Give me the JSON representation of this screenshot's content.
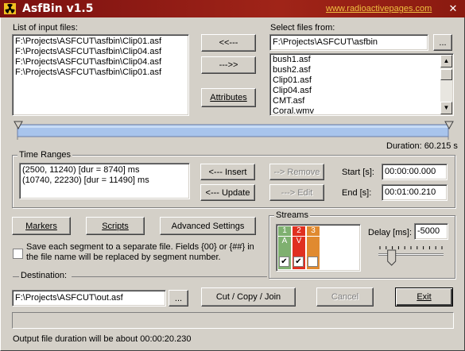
{
  "window": {
    "title": "AsfBin v1.5",
    "link": "www.radioactivepages.com",
    "close_glyph": "✕"
  },
  "input_files": {
    "label": "List of input files:",
    "items": [
      "F:\\Projects\\ASFCUT\\asfbin\\Clip01.asf",
      "F:\\Projects\\ASFCUT\\asfbin\\Clip04.asf",
      "F:\\Projects\\ASFCUT\\asfbin\\Clip04.asf",
      "F:\\Projects\\ASFCUT\\asfbin\\Clip01.asf"
    ]
  },
  "transfer": {
    "add_left": "<<---",
    "remove_right": "--->>",
    "attributes": "Attributes"
  },
  "select_files": {
    "label": "Select files from:",
    "path": "F:\\Projects\\ASFCUT\\asfbin",
    "browse": "...",
    "items": [
      "bush1.asf",
      "bush2.asf",
      "Clip01.asf",
      "Clip04.asf",
      "CMT.asf",
      "Coral.wmv"
    ]
  },
  "timeline": {
    "duration_text": "Duration: 60.215 s"
  },
  "time_ranges": {
    "title": "Time Ranges",
    "items": [
      "(2500, 11240) [dur = 8740] ms",
      "(10740, 22230) [dur = 11490] ms"
    ],
    "insert": "<---  Insert",
    "update": "<---  Update",
    "remove": "--> Remove",
    "edit": "---> Edit",
    "start_label": "Start [s]:",
    "start_value": "00:00:00.000",
    "end_label": "End [s]:",
    "end_value": "00:01:00.210"
  },
  "actions": {
    "markers": "Markers",
    "scripts": "Scripts",
    "advanced": "Advanced Settings"
  },
  "save_option": {
    "text": "Save each segment to a separate file. Fields {00} or {##} in the file name  will be replaced by segment number.",
    "checked": false
  },
  "streams": {
    "title": "Streams",
    "columns": [
      {
        "num": "1",
        "type": "A",
        "color": "#7fb070",
        "checked": true
      },
      {
        "num": "2",
        "type": "V",
        "color": "#e03020",
        "checked": true
      },
      {
        "num": "3",
        "type": "",
        "color": "#e08a30",
        "checked": false
      }
    ],
    "delay_label": "Delay [ms]:",
    "delay_value": "-5000",
    "slider_level": 0.15
  },
  "destination": {
    "label": "Destination:",
    "path": "F:\\Projects\\ASFCUT\\out.asf",
    "browse": "...",
    "cut": "Cut / Copy / Join",
    "cancel": "Cancel",
    "exit": "Exit"
  },
  "status": {
    "text": "Output file duration will be about 00:00:20.230"
  }
}
